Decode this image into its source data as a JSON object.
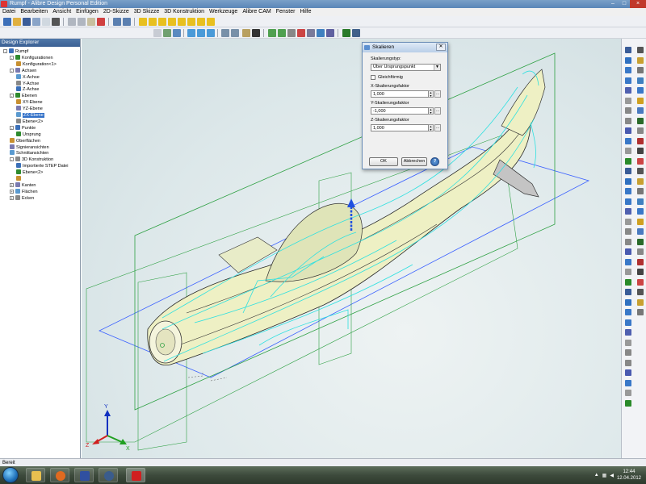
{
  "window": {
    "title": "Rumpf - Alibre Design Personal Edition"
  },
  "menu": [
    "Datei",
    "Bearbeiten",
    "Ansicht",
    "Einfügen",
    "2D-Skizze",
    "3D Skizze",
    "3D Konstruktion",
    "Werkzeuge",
    "Alibre CAM",
    "Fenster",
    "Hilfe"
  ],
  "explorer": {
    "header": "Design Explorer",
    "items": [
      {
        "label": "Rumpf",
        "level": 0,
        "expander": "-"
      },
      {
        "label": "Konfigurationen",
        "level": 1,
        "expander": "-"
      },
      {
        "label": "Konfiguration<1>",
        "level": 2,
        "expander": ""
      },
      {
        "label": "Achsen",
        "level": 1,
        "expander": "-"
      },
      {
        "label": "X-Achse",
        "level": 2,
        "expander": ""
      },
      {
        "label": "Y-Achse",
        "level": 2,
        "expander": ""
      },
      {
        "label": "Z-Achse",
        "level": 2,
        "expander": ""
      },
      {
        "label": "Ebenen",
        "level": 1,
        "expander": "-"
      },
      {
        "label": "XY-Ebene",
        "level": 2,
        "expander": ""
      },
      {
        "label": "YZ-Ebene",
        "level": 2,
        "expander": ""
      },
      {
        "label": "ZX-Ebene",
        "level": 2,
        "expander": "",
        "selected": true
      },
      {
        "label": "Ebene<2>",
        "level": 2,
        "expander": ""
      },
      {
        "label": "Punkte",
        "level": 1,
        "expander": "-"
      },
      {
        "label": "Ursprung",
        "level": 2,
        "expander": ""
      },
      {
        "label": "Oberflächen",
        "level": 1,
        "expander": ""
      },
      {
        "label": "Signieransichten",
        "level": 1,
        "expander": ""
      },
      {
        "label": "Schnittansichten",
        "level": 1,
        "expander": ""
      },
      {
        "label": "3D Konstruktion",
        "level": 1,
        "expander": "-"
      },
      {
        "label": "Importierte STEP Datei",
        "level": 2,
        "expander": ""
      },
      {
        "label": "Ebene<2>",
        "level": 2,
        "expander": ""
      },
      {
        "label": "",
        "level": 2,
        "expander": ""
      },
      {
        "label": "Kanten",
        "level": 1,
        "expander": "+"
      },
      {
        "label": "Flächen",
        "level": 1,
        "expander": "+"
      },
      {
        "label": "Ecken",
        "level": 1,
        "expander": "+"
      }
    ]
  },
  "dialog": {
    "title": "Skalieren",
    "type_label": "Skalierungstyp:",
    "type_value": "Über Ursprungspunkt",
    "uniform_label": "Gleichförmig",
    "x_label": "X-Skalierungsfaktor",
    "x_value": "1,000",
    "y_label": "Y-Skalierungsfaktor",
    "y_value": "-1,000",
    "z_label": "Z-Skalierungsfaktor",
    "z_value": "1,000",
    "ok_label": "OK",
    "cancel_label": "Abbrechen",
    "help_label": "?"
  },
  "triad": {
    "x": "X",
    "y": "Y",
    "z": "Z"
  },
  "status": {
    "text": "Bereit"
  },
  "taskbar": {
    "time": "12:44",
    "date": "12.04.2012"
  },
  "colors": {
    "titlebar": "#5a86b8",
    "selection": "#3170c8",
    "wire_green": "#2ea043",
    "wire_cyan": "#2fe0e0",
    "body_fill": "#eef0c4"
  }
}
